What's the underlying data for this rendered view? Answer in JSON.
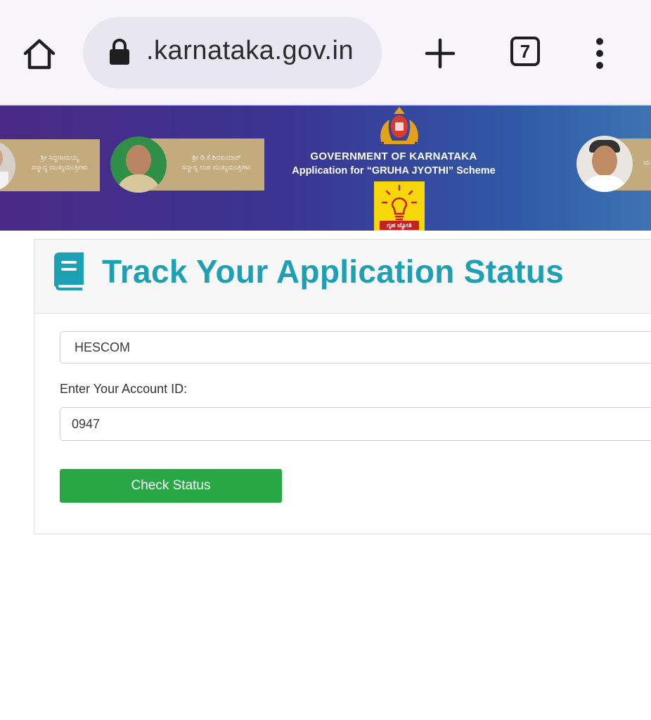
{
  "browser": {
    "url": ".karnataka.gov.in",
    "tab_count": "7",
    "icons": {
      "home": "home-icon",
      "lock": "lock-icon",
      "new_tab": "plus-icon",
      "tabs": "tabs-count-icon",
      "menu": "more-vert-icon"
    }
  },
  "banner": {
    "title": "GOVERNMENT OF KARNATAKA",
    "subtitle": "Application for “GRUHA JYOTHI” Scheme",
    "leader1_caption": "ಶ್ರೀ ಸಿದ್ದರಾಮಯ್ಯ\nಸನ್ಮಾನ್ಯ ಮುಖ್ಯಮಂತ್ರಿಗಳು",
    "leader2_caption": "ಶ್ರೀ ಡಿ.ಕೆ.ಶಿವಕುಮಾರ್\nಸನ್ಮಾನ್ಯ ಉಪ ಮುಖ್ಯಮಂತ್ರಿಗಳು",
    "leader3_caption": "ಮ",
    "scheme_logo_text": "ಗೃಹ ಜ್ಯೋತಿ",
    "colors": {
      "gradient_start": "#4a2a86",
      "gradient_end": "#3e73b3",
      "logo_yellow": "#f6d70a"
    }
  },
  "form": {
    "title": "Track Your Application Status",
    "selected_escom": "HESCOM",
    "account_label": "Enter Your Account ID:",
    "account_value": "0947",
    "submit_label": "Check Status",
    "colors": {
      "title": "#1ea0b4",
      "button": "#28a745"
    }
  }
}
